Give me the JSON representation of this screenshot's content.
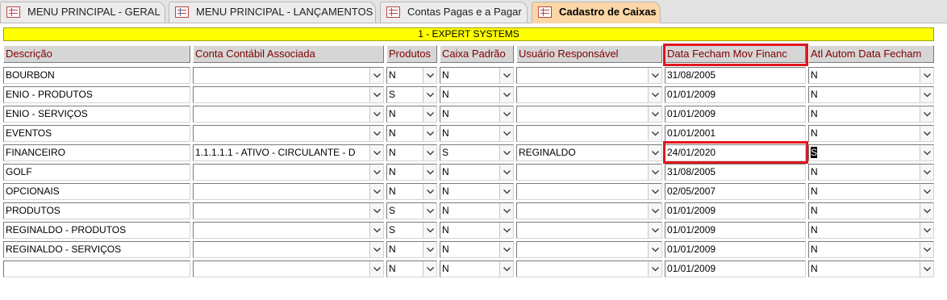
{
  "tabs": [
    {
      "label": "MENU PRINCIPAL - GERAL",
      "active": false
    },
    {
      "label": "MENU PRINCIPAL - LANÇAMENTOS",
      "active": false
    },
    {
      "label": "Contas Pagas e a Pagar",
      "active": false
    },
    {
      "label": "Cadastro de Caixas",
      "active": true
    }
  ],
  "company": "1 - EXPERT SYSTEMS",
  "columns": {
    "descricao": "Descrição",
    "conta": "Conta Contábil Associada",
    "produtos": "Produtos",
    "caixa_padrao": "Caixa Padrão",
    "usuario": "Usuário Responsável",
    "data_fecham": "Data Fecham Mov Financ",
    "atl_autom": "Atl Autom Data Fecham"
  },
  "rows": [
    {
      "descricao": "BOURBON",
      "conta": "",
      "produtos": "N",
      "caixa_padrao": "N",
      "usuario": "",
      "data_fecham": "31/08/2005",
      "atl_autom": "N"
    },
    {
      "descricao": "ENIO - PRODUTOS",
      "conta": "",
      "produtos": "S",
      "caixa_padrao": "N",
      "usuario": "",
      "data_fecham": "01/01/2009",
      "atl_autom": "N"
    },
    {
      "descricao": "ENIO - SERVIÇOS",
      "conta": "",
      "produtos": "N",
      "caixa_padrao": "N",
      "usuario": "",
      "data_fecham": "01/01/2009",
      "atl_autom": "N"
    },
    {
      "descricao": "EVENTOS",
      "conta": "",
      "produtos": "N",
      "caixa_padrao": "N",
      "usuario": "",
      "data_fecham": "01/01/2001",
      "atl_autom": "N"
    },
    {
      "descricao": "FINANCEIRO",
      "conta": "1.1.1.1.1 - ATIVO - CIRCULANTE - D",
      "produtos": "N",
      "caixa_padrao": "S",
      "usuario": "REGINALDO",
      "data_fecham": "24/01/2020",
      "atl_autom": "S"
    },
    {
      "descricao": "GOLF",
      "conta": "",
      "produtos": "N",
      "caixa_padrao": "N",
      "usuario": "",
      "data_fecham": "31/08/2005",
      "atl_autom": "N"
    },
    {
      "descricao": "OPCIONAIS",
      "conta": "",
      "produtos": "N",
      "caixa_padrao": "N",
      "usuario": "",
      "data_fecham": "02/05/2007",
      "atl_autom": "N"
    },
    {
      "descricao": "PRODUTOS",
      "conta": "",
      "produtos": "S",
      "caixa_padrao": "N",
      "usuario": "",
      "data_fecham": "01/01/2009",
      "atl_autom": "N"
    },
    {
      "descricao": "REGINALDO - PRODUTOS",
      "conta": "",
      "produtos": "S",
      "caixa_padrao": "N",
      "usuario": "",
      "data_fecham": "01/01/2009",
      "atl_autom": "N"
    },
    {
      "descricao": "REGINALDO - SERVIÇOS",
      "conta": "",
      "produtos": "N",
      "caixa_padrao": "N",
      "usuario": "",
      "data_fecham": "01/01/2009",
      "atl_autom": "N"
    },
    {
      "descricao": "",
      "conta": "",
      "produtos": "N",
      "caixa_padrao": "N",
      "usuario": "",
      "data_fecham": "01/01/2009",
      "atl_autom": "N"
    }
  ],
  "colors": {
    "company_bar": "#ffff00",
    "header_text": "#800000",
    "active_tab": "#fbd6a6",
    "highlight": "#e0161e"
  },
  "icons": {
    "tab": "form-icon",
    "combo": "chevron-down-icon"
  }
}
